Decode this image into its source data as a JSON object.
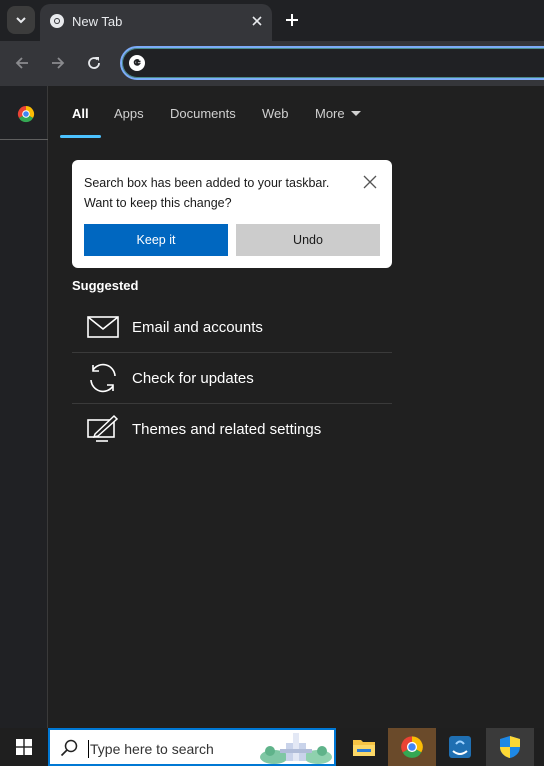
{
  "browser": {
    "tab_title": "New Tab"
  },
  "search": {
    "tabs": [
      {
        "label": "All"
      },
      {
        "label": "Apps"
      },
      {
        "label": "Documents"
      },
      {
        "label": "Web"
      },
      {
        "label": "More"
      }
    ],
    "notice": {
      "line1": "Search box has been added to your taskbar.",
      "line2": "Want to keep this change?",
      "keep_label": "Keep it",
      "undo_label": "Undo"
    },
    "suggested_title": "Suggested",
    "suggestions": [
      {
        "label": "Email and accounts",
        "icon": "mail-icon"
      },
      {
        "label": "Check for updates",
        "icon": "refresh-icon"
      },
      {
        "label": "Themes and related settings",
        "icon": "theme-pen-icon"
      }
    ]
  },
  "taskbar": {
    "search_placeholder": "Type here to search",
    "apps": [
      "file-explorer-icon",
      "chrome-icon",
      "app-icon",
      "security-shield-icon"
    ]
  },
  "colors": {
    "accent": "#0067c0",
    "tab_underline": "#4cc2ff",
    "panel_bg": "#202020"
  }
}
